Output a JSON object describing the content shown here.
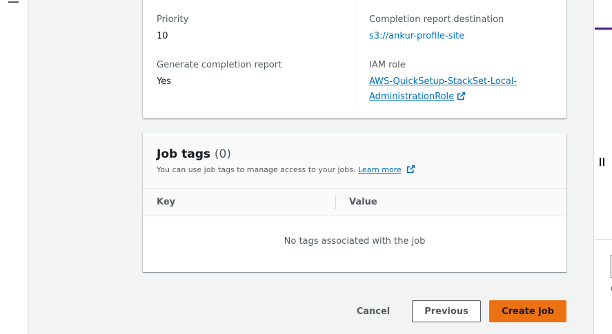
{
  "details": {
    "priority_label": "Priority",
    "priority_value": "10",
    "report_label": "Generate completion report",
    "report_value": "Yes",
    "destination_label": "Completion report destination",
    "destination_value": "s3://ankur-profile-site",
    "iam_label": "IAM role",
    "iam_value_line1": "AWS-QuickSetup-StackSet-Local-",
    "iam_value_line2": "AdministrationRole"
  },
  "job_tags": {
    "title": "Job tags",
    "count": "(0)",
    "description": "You can use job tags to manage access to your jobs.",
    "learn_more": "Learn more",
    "columns": [
      "Key",
      "Value"
    ],
    "empty_message": "No tags associated with the job"
  },
  "actions": {
    "cancel": "Cancel",
    "previous": "Previous",
    "create": "Create job"
  },
  "colors": {
    "link": "#0073bb",
    "primary_button": "#ec7211",
    "accent": "#4b1b8f"
  },
  "icons": [
    "menu-icon",
    "external-link-icon",
    "pause-icon"
  ]
}
